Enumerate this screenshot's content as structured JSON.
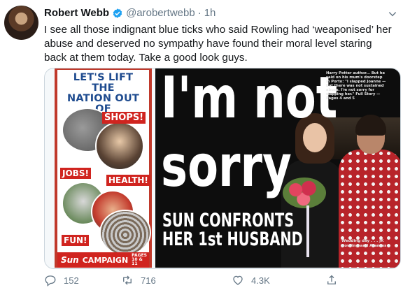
{
  "tweet": {
    "author_name": "Robert Webb",
    "handle": "@arobertwebb",
    "separator": "·",
    "time": "1h",
    "text": "I see all those indignant blue ticks who said Rowling had ‘weaponised’ her abuse and deserved no sympathy have found their moral level staring back at them today. Take a good look guys."
  },
  "media": {
    "left_paper": {
      "headline": "LET'S LIFT THE\nNATION OUT\nOF LOCKDOWN",
      "tags": [
        "SHOPS!",
        "JOBS!",
        "HEALTH!",
        "FUN!"
      ],
      "logo": "Sun",
      "campaign_label": "CAMPAIGN",
      "campaign_pages": "PAGES 10 & 11"
    },
    "right_paper": {
      "headline_line1": "I'm not",
      "headline_line2": "sorry",
      "subheadline": "SUN CONFRONTS\nHER 1st HUSBAND",
      "snippet": "Harry Potter author... But he said on his mum's doorstep in Porto: \"I slapped Joanne — but there was not sustained abuse. I'm not sorry for slapping her.\" Full Story — Pages 4 and 5",
      "caption": "Wedding day . . . JK Rowling and Arantes"
    }
  },
  "actions": {
    "replies": "152",
    "retweets": "716",
    "likes": "4.3K"
  },
  "colors": {
    "verified_blue": "#1da1f2",
    "muted_text": "#657786",
    "sun_red": "#d0241f",
    "headline_blue": "#1e4b8f"
  },
  "icons": [
    "verified-badge-icon",
    "chevron-down-icon",
    "reply-icon",
    "retweet-icon",
    "like-icon",
    "share-icon"
  ]
}
